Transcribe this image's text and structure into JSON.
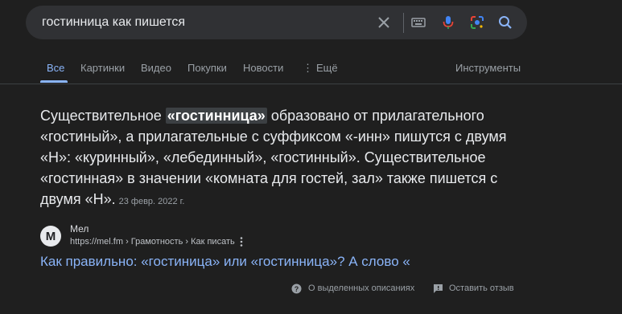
{
  "search": {
    "query": "гостинница как пишется"
  },
  "icons": {
    "clear": "close-icon",
    "keyboard": "keyboard-icon",
    "voice": "microphone-icon",
    "lens": "lens-icon",
    "search": "search-icon"
  },
  "tabs": [
    {
      "label": "Все",
      "active": true
    },
    {
      "label": "Картинки"
    },
    {
      "label": "Видео"
    },
    {
      "label": "Покупки"
    },
    {
      "label": "Новости"
    },
    {
      "label": "Ещё"
    }
  ],
  "tools_label": "Инструменты",
  "snippet": {
    "before": "Существительное ",
    "highlight": "«гостинница»",
    "after": " образовано от прилагательного «гостиный», а прилагательные с суффиксом «-инн» пишутся с двумя «Н»: «куринный», «лебединный», «гостинный». Существительное «гостинная» в значении «комната для гостей, зал» также пишется с двумя «Н».",
    "date": "23 февр. 2022 г."
  },
  "result": {
    "favicon_letter": "М",
    "site_name": "Мел",
    "url": "https://mel.fm › Грамотность › Как писать",
    "title": "Как правильно: «гостиница» или «гостинница»? А слово «"
  },
  "footer": {
    "about_label": "О выделенных описаниях",
    "feedback_label": "Оставить отзыв"
  },
  "colors": {
    "background": "#1f1f1f",
    "link": "#8ab4f8",
    "text": "#e8eaed",
    "muted": "#9aa0a6"
  }
}
